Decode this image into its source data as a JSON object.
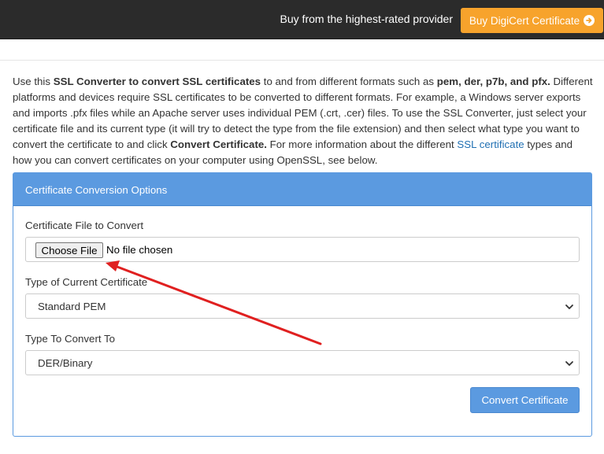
{
  "topbar": {
    "tagline": "Buy from the highest-rated provider",
    "buy_button_label": "Buy DigiCert Certificate",
    "buy_button_icon": "arrow-circle-right-icon",
    "accent_color": "#f7a32c"
  },
  "intro": {
    "s1": "Use this ",
    "s1_bold": "SSL Converter to convert SSL certificates",
    "s2": " to and from different formats such as ",
    "s2_bold": "pem, der, p7b, and pfx.",
    "s3": " Different platforms and devices require SSL certificates to be converted to different formats. For example, a Windows server exports and imports .pfx files while an Apache server uses individual PEM (.crt, .cer) files. To use the SSL Converter, just select your certificate file and its current type (it will try to detect the type from the file extension) and then select what type you want to convert the certificate to and click ",
    "s3_bold": "Convert Certificate.",
    "s4": " For more information about the different ",
    "link": "SSL certificate",
    "s5": " types and how you can convert certificates on your computer using OpenSSL, see below."
  },
  "panel": {
    "heading": "Certificate Conversion Options",
    "color": "#5b9ae0",
    "file_label": "Certificate File to Convert",
    "choose_file_label": "Choose File",
    "no_file_text": "No file chosen",
    "current_type_label": "Type of Current Certificate",
    "current_type_value": "Standard PEM",
    "convert_to_label": "Type To Convert To",
    "convert_to_value": "DER/Binary",
    "convert_button_label": "Convert Certificate"
  },
  "annotation": {
    "arrow_color": "#e02020"
  }
}
